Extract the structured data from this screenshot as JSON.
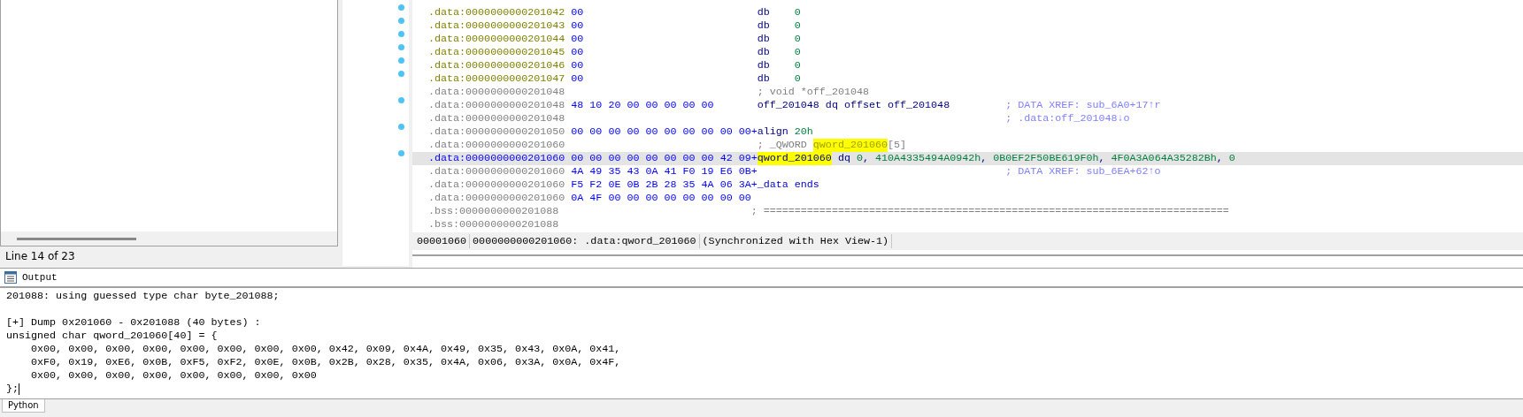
{
  "left_panel": {
    "status": "Line 14 of 23"
  },
  "listing": {
    "rows": [
      {
        "address": ".data:0000000000201042",
        "kind": "defined",
        "marker": true,
        "selected": false,
        "bytes": "00",
        "code": [
          {
            "text": "db    ",
            "kind": "mnemonic"
          },
          {
            "text": "0",
            "kind": "number"
          }
        ]
      },
      {
        "address": ".data:0000000000201043",
        "kind": "defined",
        "marker": true,
        "selected": false,
        "bytes": "00",
        "code": [
          {
            "text": "db    ",
            "kind": "mnemonic"
          },
          {
            "text": "0",
            "kind": "number"
          }
        ]
      },
      {
        "address": ".data:0000000000201044",
        "kind": "defined",
        "marker": true,
        "selected": false,
        "bytes": "00",
        "code": [
          {
            "text": "db    ",
            "kind": "mnemonic"
          },
          {
            "text": "0",
            "kind": "number"
          }
        ]
      },
      {
        "address": ".data:0000000000201045",
        "kind": "defined",
        "marker": true,
        "selected": false,
        "bytes": "00",
        "code": [
          {
            "text": "db    ",
            "kind": "mnemonic"
          },
          {
            "text": "0",
            "kind": "number"
          }
        ]
      },
      {
        "address": ".data:0000000000201046",
        "kind": "defined",
        "marker": true,
        "selected": false,
        "bytes": "00",
        "code": [
          {
            "text": "db    ",
            "kind": "mnemonic"
          },
          {
            "text": "0",
            "kind": "number"
          }
        ]
      },
      {
        "address": ".data:0000000000201047",
        "kind": "defined",
        "marker": true,
        "selected": false,
        "bytes": "00",
        "code": [
          {
            "text": "db    ",
            "kind": "mnemonic"
          },
          {
            "text": "0",
            "kind": "number"
          }
        ]
      },
      {
        "address": ".data:0000000000201048",
        "kind": "plain",
        "marker": false,
        "selected": false,
        "code": [
          {
            "text": "; void *off_201048",
            "kind": "comment"
          }
        ]
      },
      {
        "address": ".data:0000000000201048",
        "kind": "plain",
        "marker": true,
        "selected": false,
        "bytes": "48 10 20 00 00 00 00 00",
        "code": [
          {
            "text": "off_201048",
            "kind": "mnemonic"
          },
          {
            "text": " dq offset ",
            "kind": "mnemonic"
          },
          {
            "text": "off_201048",
            "kind": "mnemonic"
          }
        ],
        "comment": "; DATA XREF: sub_6A0+17↑r"
      },
      {
        "address": ".data:0000000000201048",
        "kind": "plain",
        "marker": false,
        "selected": false,
        "comment": "; .data:off_201048↓o"
      },
      {
        "address": ".data:0000000000201050",
        "kind": "plain",
        "marker": true,
        "selected": false,
        "bytes": "00 00 00 00 00 00 00 00 00 00+",
        "code": [
          {
            "text": "align ",
            "kind": "mnemonic"
          },
          {
            "text": "20h",
            "kind": "number"
          }
        ]
      },
      {
        "address": ".data:0000000000201060",
        "kind": "plain",
        "marker": false,
        "selected": false,
        "code": [
          {
            "text": "; _QWORD ",
            "kind": "comment"
          },
          {
            "text": "qword_201060",
            "kind": "highlight"
          },
          {
            "text": "[5]",
            "kind": "comment"
          }
        ]
      },
      {
        "address": ".data:0000000000201060",
        "kind": "current",
        "marker": true,
        "selected": true,
        "bytes": "00 00 00 00 00 00 00 00 42 09+",
        "code": [
          {
            "text": "qword_201060",
            "kind": "highlight-name"
          },
          {
            "text": " dq ",
            "kind": "mnemonic"
          },
          {
            "text": "0",
            "kind": "number"
          },
          {
            "text": ", ",
            "kind": "mnemonic"
          },
          {
            "text": "410A4335494A0942h",
            "kind": "number"
          },
          {
            "text": ", ",
            "kind": "mnemonic"
          },
          {
            "text": "0B0EF2F50BE619F0h",
            "kind": "number"
          },
          {
            "text": ", ",
            "kind": "mnemonic"
          },
          {
            "text": "4F0A3A064A35282Bh",
            "kind": "number"
          },
          {
            "text": ", ",
            "kind": "mnemonic"
          },
          {
            "text": "0",
            "kind": "number"
          }
        ]
      },
      {
        "address": ".data:0000000000201060",
        "kind": "plain",
        "marker": false,
        "selected": false,
        "bytes": "4A 49 35 43 0A 41 F0 19 E6 0B+",
        "comment": "; DATA XREF: sub_6EA+62↑o"
      },
      {
        "address": ".data:0000000000201060",
        "kind": "plain",
        "marker": false,
        "selected": false,
        "bytes": "F5 F2 0E 0B 2B 28 35 4A 06 3A+",
        "code": [
          {
            "text": "_data ends",
            "kind": "directive"
          }
        ]
      },
      {
        "address": ".data:0000000000201060",
        "kind": "plain",
        "marker": false,
        "selected": false,
        "bytes": "0A 4F 00 00 00 00 00 00 00 00"
      },
      {
        "address": ".bss:0000000000201088",
        "kind": "plain",
        "marker": false,
        "selected": false,
        "code": [
          {
            "text": "; ===========================================================================",
            "kind": "comment"
          }
        ]
      },
      {
        "address": ".bss:0000000000201088",
        "kind": "plain",
        "marker": false,
        "selected": false
      }
    ],
    "status_bar": [
      "00001060",
      "0000000000201060: .data:qword_201060",
      "(Synchronized with Hex View-1)"
    ]
  },
  "output": {
    "title": "Output",
    "paragraphs": [
      [
        "201088: using guessed type char byte_201088;"
      ],
      [
        "[+] Dump 0x201060 - 0x201088 (40 bytes) :",
        "unsigned char qword_201060[40] = {",
        "    0x00, 0x00, 0x00, 0x00, 0x00, 0x00, 0x00, 0x00, 0x42, 0x09, 0x4A, 0x49, 0x35, 0x43, 0x0A, 0x41,",
        "    0xF0, 0x19, 0xE6, 0x0B, 0xF5, 0xF2, 0x0E, 0x0B, 0x2B, 0x28, 0x35, 0x4A, 0x06, 0x3A, 0x0A, 0x4F,",
        "    0x00, 0x00, 0x00, 0x00, 0x00, 0x00, 0x00, 0x00",
        "};"
      ]
    ]
  },
  "tabs": [
    {
      "label": "Python",
      "selected": true
    }
  ]
}
